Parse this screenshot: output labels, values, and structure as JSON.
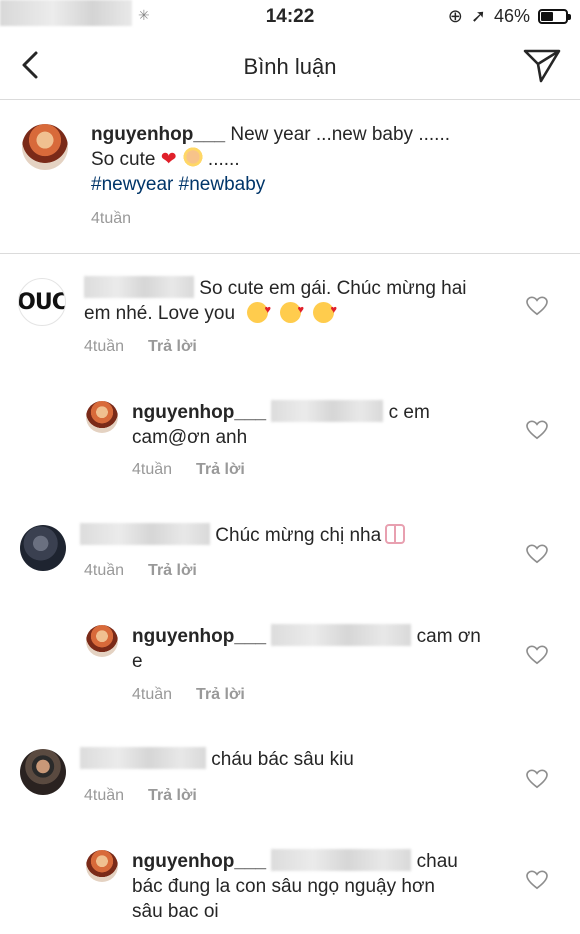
{
  "status_bar": {
    "time": "14:22",
    "battery": "46%"
  },
  "nav": {
    "title": "Bình luận"
  },
  "caption": {
    "username": "nguyenhop___",
    "text_line1": "New year ...new baby ......",
    "text_line2_pre": "So cute",
    "text_line2_post": "......",
    "hashtags": "#newyear #newbaby",
    "time": "4tuần"
  },
  "comments": [
    {
      "avatar_text": "OUC",
      "line1": "So cute em gái. Chúc mừng hai",
      "line2": "em nhé. Love you",
      "time": "4tuần",
      "reply": "Trả lời"
    },
    {
      "username": "nguyenhop___",
      "line1_tail": "c em",
      "line2": "cam@ơn anh",
      "time": "4tuần",
      "reply": "Trả lời"
    },
    {
      "line1": "Chúc mừng chị nha",
      "time": "4tuần",
      "reply": "Trả lời"
    },
    {
      "username": "nguyenhop___",
      "line1_tail": "cam ơn",
      "line2": "e",
      "time": "4tuần",
      "reply": "Trả lời"
    },
    {
      "line1": "cháu bác sâu kiu",
      "time": "4tuần",
      "reply": "Trả lời"
    },
    {
      "username": "nguyenhop___",
      "line1_tail": "chau",
      "line2": "bác đung la con sâu ngọ nguậy hơn",
      "line3": "sâu bac oi"
    }
  ],
  "colors": {
    "hashtag": "#003569",
    "meta": "#999999",
    "divider": "#dbdbdb"
  }
}
